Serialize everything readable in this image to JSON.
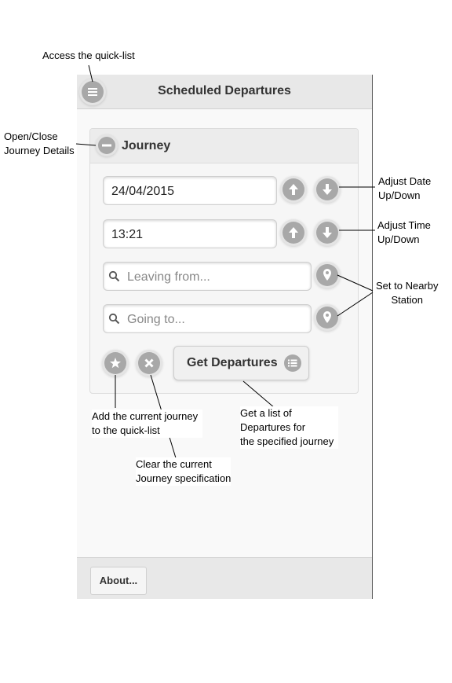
{
  "header": {
    "title": "Scheduled Departures"
  },
  "journey": {
    "title": "Journey",
    "date_value": "24/04/2015",
    "time_value": "13:21",
    "from_placeholder": "Leaving from...",
    "to_placeholder": "Going to...",
    "get_departures_label": "Get Departures"
  },
  "footer": {
    "about_label": "About..."
  },
  "annotations": {
    "quick_list": "Access the quick-list",
    "open_close_1": "Open/Close",
    "open_close_2": "Journey Details",
    "adjust_date_1": "Adjust Date",
    "adjust_date_2": "Up/Down",
    "adjust_time_1": "Adjust Time",
    "adjust_time_2": "Up/Down",
    "nearby_1": "Set to Nearby",
    "nearby_2": "Station",
    "add_quick_1": "Add the current journey",
    "add_quick_2": "to the quick-list",
    "clear_1": "Clear the current",
    "clear_2": "Journey specification",
    "get_list_1": "Get a list of",
    "get_list_2": "Departures for",
    "get_list_3": "the specified journey"
  },
  "icons": [
    "menu-icon",
    "minus-icon",
    "arrow-up-icon",
    "arrow-down-icon",
    "search-icon",
    "location-pin-icon",
    "star-icon",
    "close-icon",
    "list-icon"
  ],
  "colors": {
    "icon_bg": "#a8a8a8",
    "header_bg": "#e8e8e8",
    "panel_bg": "#f6f6f6"
  }
}
